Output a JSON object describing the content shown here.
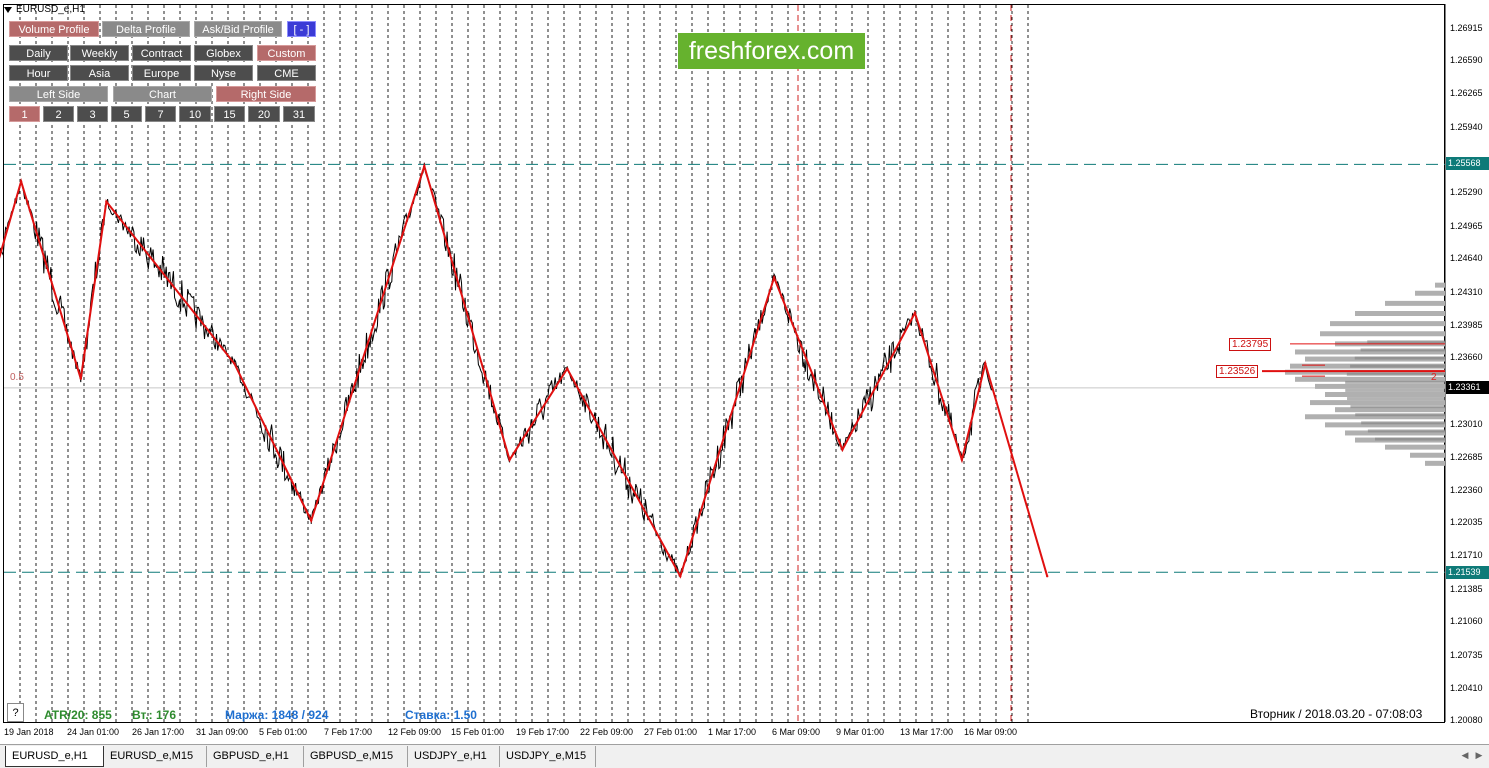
{
  "window": {
    "title": "EURUSD_e,H1"
  },
  "panel": {
    "row1": [
      {
        "label": "Volume Profile",
        "style": "red"
      },
      {
        "label": "Delta Profile",
        "style": "gray"
      },
      {
        "label": "Ask/Bid Profile",
        "style": "gray"
      },
      {
        "label": "[ - ]",
        "style": "blue"
      }
    ],
    "row2": [
      {
        "label": "Daily",
        "style": "dark"
      },
      {
        "label": "Weekly",
        "style": "dark"
      },
      {
        "label": "Contract",
        "style": "dark"
      },
      {
        "label": "Globex",
        "style": "dark"
      },
      {
        "label": "Custom",
        "style": "red"
      }
    ],
    "row3": [
      {
        "label": "Hour",
        "style": "dark"
      },
      {
        "label": "Asia",
        "style": "dark"
      },
      {
        "label": "Europe",
        "style": "dark"
      },
      {
        "label": "Nyse",
        "style": "dark"
      },
      {
        "label": "CME",
        "style": "dark"
      }
    ],
    "row4": [
      {
        "label": "Left Side",
        "style": "gray"
      },
      {
        "label": "Chart",
        "style": "gray"
      },
      {
        "label": "Right Side",
        "style": "red"
      }
    ],
    "row5": [
      {
        "label": "1",
        "style": "red"
      },
      {
        "label": "2",
        "style": "dark"
      },
      {
        "label": "3",
        "style": "dark"
      },
      {
        "label": "5",
        "style": "dark"
      },
      {
        "label": "7",
        "style": "dark"
      },
      {
        "label": "10",
        "style": "dark"
      },
      {
        "label": "15",
        "style": "dark"
      },
      {
        "label": "20",
        "style": "dark"
      },
      {
        "label": "31",
        "style": "dark"
      }
    ]
  },
  "logo": {
    "text": "freshforex.com",
    "color": "#66b22e"
  },
  "labels": {
    "fib_half": "0.5",
    "profile_level": "2",
    "poc_price": "1.23526",
    "upper_price": "1.23795"
  },
  "price_axis": {
    "ticks": [
      "1.26915",
      "1.26590",
      "1.26265",
      "1.25940",
      "1.25290",
      "1.24965",
      "1.24640",
      "1.24310",
      "1.23985",
      "1.23660",
      "1.23010",
      "1.22685",
      "1.22360",
      "1.22035",
      "1.21710",
      "1.21385",
      "1.21060",
      "1.20735",
      "1.20410",
      "1.20080"
    ],
    "tags": [
      {
        "value": "1.25568",
        "color": "#0e7a78"
      },
      {
        "value": "1.23361",
        "color": "#000000"
      },
      {
        "value": "1.21539",
        "color": "#0e7a78"
      }
    ]
  },
  "time_axis": {
    "labels": [
      "19 Jan 2018",
      "24 Jan 01:00",
      "26 Jan 17:00",
      "31 Jan 09:00",
      "5 Feb 01:00",
      "7 Feb 17:00",
      "12 Feb 09:00",
      "15 Feb 01:00",
      "19 Feb 17:00",
      "22 Feb 09:00",
      "27 Feb 01:00",
      "1 Mar 17:00",
      "6 Mar 09:00",
      "9 Mar 01:00",
      "13 Mar 17:00",
      "16 Mar 09:00"
    ]
  },
  "info": {
    "atr": "ATR/20: 855",
    "volume": "Вт.: 176",
    "margin": "Маржа: 1848 / 924",
    "rate": "Ставка: 1.50",
    "datetime": "Вторник  /  2018.03.20  -  07:08:03",
    "help": "?"
  },
  "tabs": [
    "EURUSD_e,H1",
    "EURUSD_e,M15",
    "GBPUSD_e,H1",
    "GBPUSD_e,M15",
    "USDJPY_e,H1",
    "USDJPY_e,M15"
  ],
  "colors": {
    "zigzag": "#e01010",
    "support_line": "#0e7a78",
    "profile": "#b0b0b0",
    "profile_dark": "#808080",
    "atr_text": "#2e8b2e",
    "margin_text": "#1e6fd0"
  },
  "chart_data": {
    "type": "line",
    "symbol": "EURUSD_e",
    "timeframe": "H1",
    "current_price": 1.23361,
    "levels": {
      "resistance": 1.25568,
      "support": 1.21539,
      "poc": 1.23526,
      "upper_value_area": 1.23795
    },
    "zigzag": [
      {
        "x": "18 Jan 17:00",
        "y": 1.226
      },
      {
        "x": "23 Jan 21:00",
        "y": 1.254
      },
      {
        "x": "26 Jan 05:00",
        "y": 1.2345
      },
      {
        "x": "29 Jan 05:00",
        "y": 1.252
      },
      {
        "x": "5 Feb 05:00",
        "y": 1.236
      },
      {
        "x": "8 Feb 05:00",
        "y": 1.2205
      },
      {
        "x": "14 Feb 15:00",
        "y": 1.2555
      },
      {
        "x": "19 Feb 23:00",
        "y": 1.2265
      },
      {
        "x": "22 Feb 05:00",
        "y": 1.2355
      },
      {
        "x": "28 Feb 15:00",
        "y": 1.215
      },
      {
        "x": "6 Mar 07:00",
        "y": 1.2445
      },
      {
        "x": "8 Mar 23:00",
        "y": 1.2275
      },
      {
        "x": "13 Mar 19:00",
        "y": 1.241
      },
      {
        "x": "15 Mar 15:00",
        "y": 1.2265
      },
      {
        "x": "16 Mar 13:00",
        "y": 1.236
      },
      {
        "x": "20 Mar 23:00",
        "y": 1.215
      }
    ]
  }
}
